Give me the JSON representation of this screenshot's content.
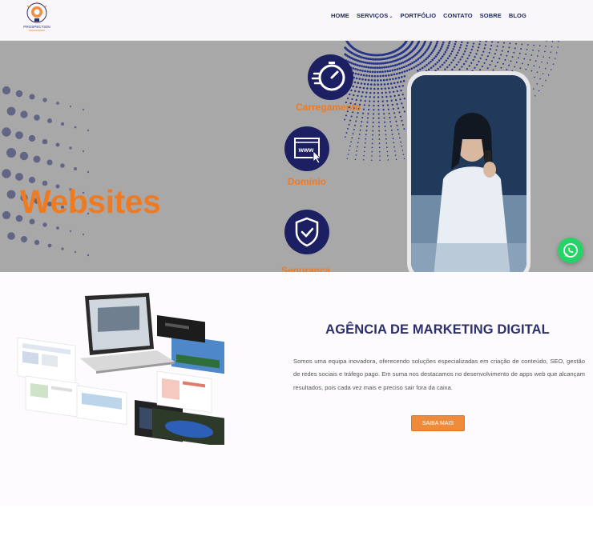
{
  "brand": {
    "logo_text": "PROSPECTION"
  },
  "nav": {
    "items": [
      {
        "label": "HOME"
      },
      {
        "label": "SERVIÇOS",
        "caret": "⌄"
      },
      {
        "label": "PORTFÓLIO"
      },
      {
        "label": "CONTATO"
      },
      {
        "label": "SOBRE"
      },
      {
        "label": "BLOG"
      }
    ]
  },
  "hero": {
    "title": "Websites",
    "features": [
      {
        "label": "Carregamento",
        "icon": "speedometer-icon"
      },
      {
        "label": "Domínio",
        "icon": "www-browser-icon"
      },
      {
        "label": "Segurança",
        "icon": "shield-check-icon"
      }
    ],
    "colors": {
      "accent": "#ee7a22",
      "navy": "#1d1f63",
      "background": "#a9a8a8"
    }
  },
  "whatsapp": {
    "icon": "whatsapp-icon",
    "color": "#25d366"
  },
  "section": {
    "title": "AGÊNCIA DE MARKETING DIGITAL",
    "text": "Somos uma equipa inovadora, oferecendo soluções especializadas em criação de conteúdo, SEO, gestão de redes sociais e tráfego pago. Em suma nos destacamos no desenvolvimento de apps web que alcançam resultados, pois cada vez mais e preciso sair fora da caixa.",
    "button": "SAIBA MAIS"
  }
}
